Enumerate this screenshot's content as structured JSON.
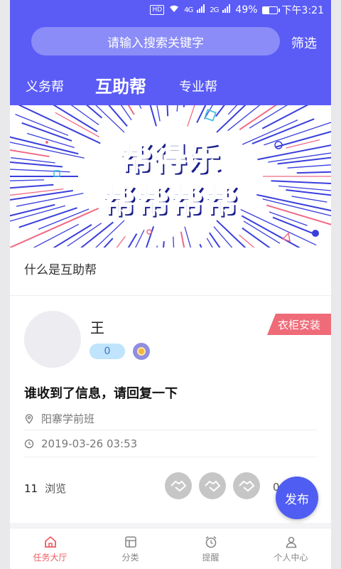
{
  "status_bar": {
    "hd": "HD",
    "net1": "4G",
    "net2": "2G",
    "battery": "49%",
    "battery_level": 0.49,
    "time": "下午3:21"
  },
  "header": {
    "search_placeholder": "请输入搜索关键字",
    "filter_label": "筛选",
    "tabs": [
      {
        "label": "义务帮"
      },
      {
        "label": "互助帮",
        "active": true
      },
      {
        "label": "专业帮"
      }
    ]
  },
  "banner": {
    "line1": "帮得乐",
    "line2": "帮帮帮帮"
  },
  "info_link": "什么是互助帮",
  "post": {
    "user_name": "王",
    "points": "0",
    "medal_icon": "medal-icon",
    "tag": "衣柜安装",
    "title": "谁收到了信息，请回复一下",
    "location": "阳寨学前班",
    "datetime": "2019-03-26 03:53",
    "views_count": "11",
    "views_label": "浏览",
    "help_count": "0"
  },
  "fab_label": "发布",
  "tabbar": [
    {
      "label": "任务大厅",
      "icon": "home-icon",
      "active": true
    },
    {
      "label": "分类",
      "icon": "category-icon"
    },
    {
      "label": "提醒",
      "icon": "alarm-icon"
    },
    {
      "label": "个人中心",
      "icon": "user-icon"
    }
  ],
  "colors": {
    "primary": "#5b5cf6",
    "tag": "#ef6b78",
    "active_tab": "#ef5b64"
  }
}
